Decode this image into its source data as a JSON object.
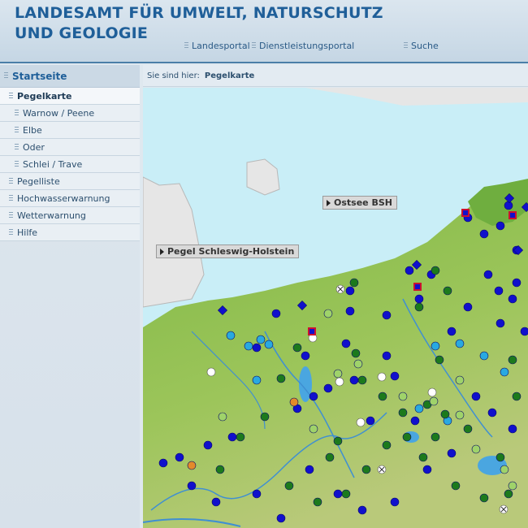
{
  "header": {
    "title_line1": "LANDESAMT FÜR UMWELT, NATURSCHUTZ",
    "title_line2": "UND GEOLOGIE",
    "links": [
      "Landesportal",
      "Dienstleistungsportal",
      "Suche"
    ]
  },
  "sidebar": {
    "heading": "Startseite",
    "items": [
      {
        "label": "Pegelkarte",
        "level": 0,
        "active": true
      },
      {
        "label": "Warnow / Peene",
        "level": 1
      },
      {
        "label": "Elbe",
        "level": 1
      },
      {
        "label": "Oder",
        "level": 1
      },
      {
        "label": "Schlei / Trave",
        "level": 1
      },
      {
        "label": "Pegelliste",
        "level": 0
      },
      {
        "label": "Hochwasserwarnung",
        "level": 0
      },
      {
        "label": "Wetterwarnung",
        "level": 0
      },
      {
        "label": "Hilfe",
        "level": 0
      }
    ]
  },
  "breadcrumb": {
    "prefix": "Sie sind hier:",
    "current": "Pegelkarte"
  },
  "map": {
    "labels": [
      "Ostsee BSH",
      "Pegel Schleswig-Holstein"
    ]
  },
  "colors": {
    "brand": "#1f5f99",
    "sea": "#c9eef7",
    "land": "#8bbd4e",
    "marker_dark_blue": "#1010cc",
    "marker_light_blue": "#29a9e0",
    "marker_green": "#1c7a1c",
    "marker_light_green": "#9fd36a"
  }
}
